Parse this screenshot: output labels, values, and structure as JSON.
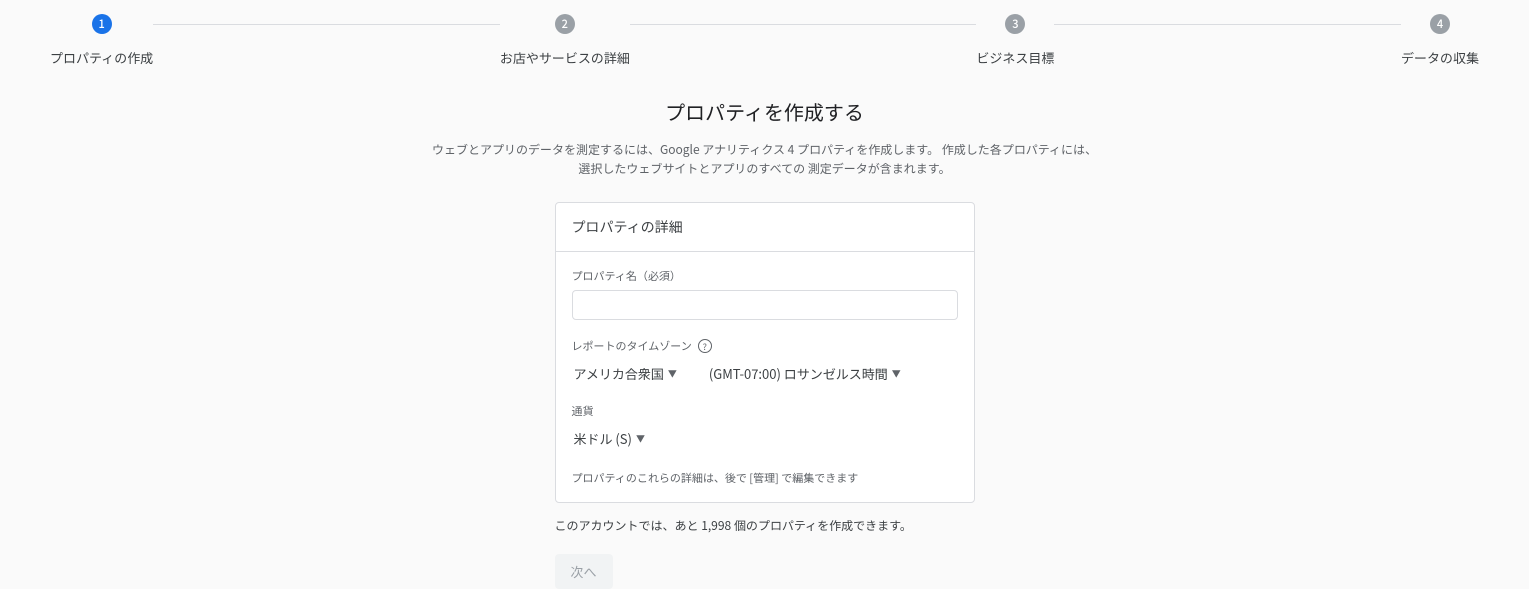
{
  "stepper": {
    "steps": [
      {
        "num": "1",
        "label": "プロパティの作成",
        "active": true
      },
      {
        "num": "2",
        "label": "お店やサービスの詳細",
        "active": false
      },
      {
        "num": "3",
        "label": "ビジネス目標",
        "active": false
      },
      {
        "num": "4",
        "label": "データの収集",
        "active": false
      }
    ]
  },
  "main": {
    "title": "プロパティを作成する",
    "desc_line1": "ウェブとアプリのデータを測定するには、Google アナリティクス 4 プロパティを作成します。 作成した各プロパティには、",
    "desc_line2": "選択したウェブサイトとアプリのすべての 測定データが含まれます。"
  },
  "card": {
    "header": "プロパティの詳細",
    "name_label": "プロパティ名（必須）",
    "name_value": "",
    "timezone_label": "レポートのタイムゾーン",
    "country_value": "アメリカ合衆国",
    "timezone_value": "(GMT-07:00) ロサンゼルス時間",
    "currency_label": "通貨",
    "currency_value": "米ドル (S)",
    "edit_note": "プロパティのこれらの詳細は、後で [管理] で編集できます"
  },
  "footer": {
    "account_note": "このアカウントでは、あと 1,998 個のプロパティを作成できます。",
    "next_label": "次へ"
  }
}
